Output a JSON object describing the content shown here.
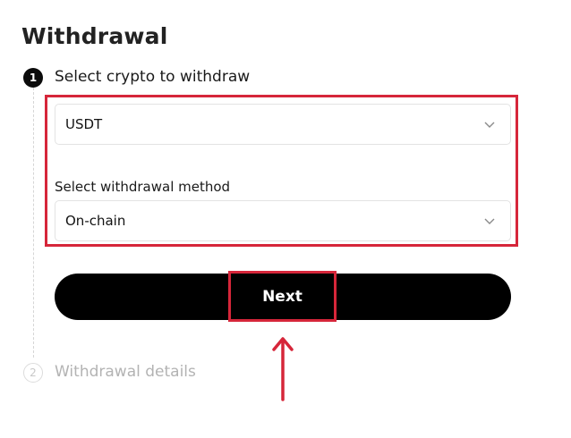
{
  "page": {
    "title": "Withdrawal"
  },
  "steps": [
    {
      "number": "1",
      "label": "Select crypto to withdraw",
      "state": "active"
    },
    {
      "number": "2",
      "label": "Withdrawal details",
      "state": "inactive"
    }
  ],
  "crypto_select": {
    "value": "USDT",
    "icon": "chevron-down-icon"
  },
  "method_select": {
    "label": "Select withdrawal method",
    "value": "On-chain",
    "icon": "chevron-down-icon"
  },
  "next_button": {
    "label": "Next"
  },
  "annotation": {
    "color": "#d6263a",
    "pointer_icon": "up-arrow-icon"
  }
}
